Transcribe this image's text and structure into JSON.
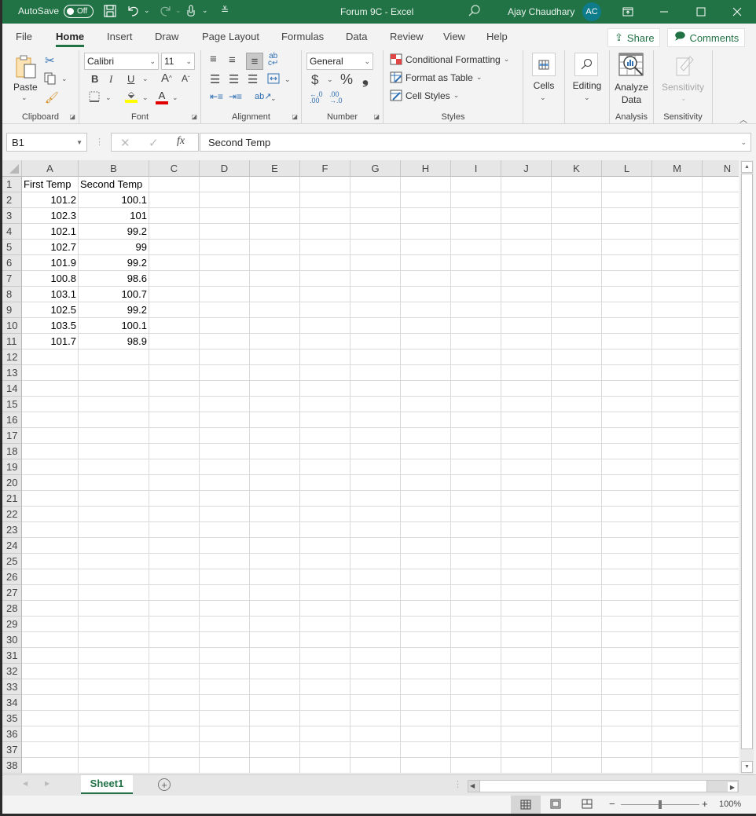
{
  "titlebar": {
    "autosave_label": "AutoSave",
    "autosave_state": "Off",
    "doc_title": "Forum 9C  -  Excel",
    "user_name": "Ajay Chaudhary",
    "user_initials": "AC",
    "accent_color": "#217346"
  },
  "tabs": [
    {
      "label": "File"
    },
    {
      "label": "Home",
      "active": true
    },
    {
      "label": "Insert"
    },
    {
      "label": "Draw"
    },
    {
      "label": "Page Layout"
    },
    {
      "label": "Formulas"
    },
    {
      "label": "Data"
    },
    {
      "label": "Review"
    },
    {
      "label": "View"
    },
    {
      "label": "Help"
    }
  ],
  "share_label": "Share",
  "comments_label": "Comments",
  "ribbon": {
    "clipboard": {
      "label": "Clipboard",
      "paste": "Paste"
    },
    "font": {
      "label": "Font",
      "font_name": "Calibri",
      "font_size": "11"
    },
    "alignment": {
      "label": "Alignment"
    },
    "number": {
      "label": "Number",
      "format": "General",
      "currency": "$",
      "percent": "%",
      "comma": "❟"
    },
    "styles": {
      "label": "Styles",
      "conditional": "Conditional Formatting",
      "format_table": "Format as Table",
      "cell_styles": "Cell Styles"
    },
    "cells": {
      "label": "Cells"
    },
    "editing": {
      "label": "Editing"
    },
    "analysis": {
      "label": "Analysis",
      "analyze_line1": "Analyze",
      "analyze_line2": "Data"
    },
    "sensitivity": {
      "label": "Sensitivity",
      "button": "Sensitivity"
    }
  },
  "formula_bar": {
    "name_box": "B1",
    "fx": "fx",
    "content": "Second Temp"
  },
  "columns": [
    "A",
    "B",
    "C",
    "D",
    "E",
    "F",
    "G",
    "H",
    "I",
    "J",
    "K",
    "L",
    "M",
    "N"
  ],
  "rows": [
    "1",
    "2",
    "3",
    "4",
    "5",
    "6",
    "7",
    "8",
    "9",
    "10",
    "11",
    "12",
    "13",
    "14",
    "15",
    "16",
    "17",
    "18",
    "19",
    "20",
    "21",
    "22",
    "23",
    "24",
    "25",
    "26",
    "27",
    "28",
    "29",
    "30",
    "31",
    "32",
    "33",
    "34",
    "35",
    "36",
    "37",
    "38"
  ],
  "table": {
    "headers": [
      "First Temp",
      "Second Temp"
    ],
    "rows": [
      [
        "101.2",
        "100.1"
      ],
      [
        "102.3",
        "101"
      ],
      [
        "102.1",
        "99.2"
      ],
      [
        "102.7",
        "99"
      ],
      [
        "101.9",
        "99.2"
      ],
      [
        "100.8",
        "98.6"
      ],
      [
        "103.1",
        "100.7"
      ],
      [
        "102.5",
        "99.2"
      ],
      [
        "103.5",
        "100.1"
      ],
      [
        "101.7",
        "98.9"
      ]
    ]
  },
  "sheets": [
    {
      "name": "Sheet1",
      "active": true
    }
  ],
  "status": {
    "zoom": "100%",
    "zoom_level_percent": 100
  }
}
